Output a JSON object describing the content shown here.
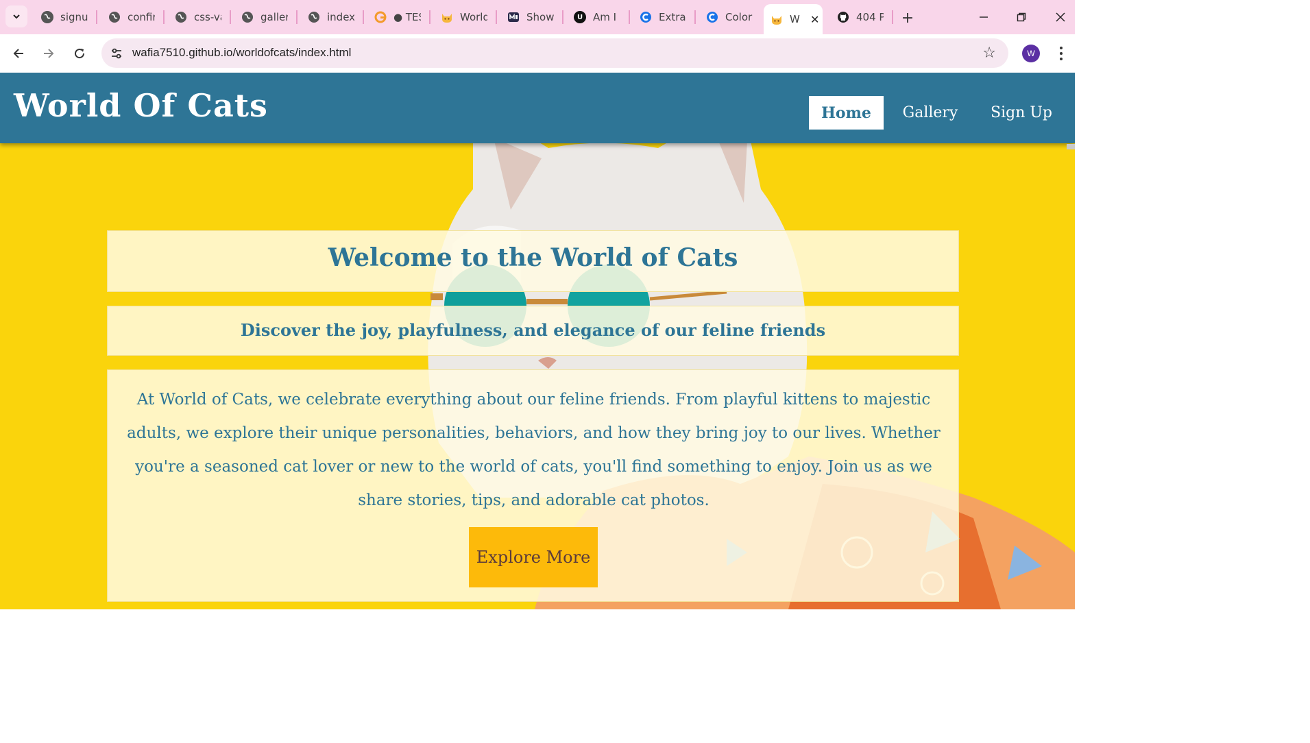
{
  "browser": {
    "tabs": [
      {
        "title": "signup",
        "icon": "globe-icon"
      },
      {
        "title": "confirm",
        "icon": "globe-icon"
      },
      {
        "title": "css-va",
        "icon": "globe-icon"
      },
      {
        "title": "gallery",
        "icon": "globe-icon"
      },
      {
        "title": "index",
        "icon": "globe-icon"
      },
      {
        "title": "● TES",
        "icon": "grammarly-icon"
      },
      {
        "title": "World",
        "icon": "cat-icon"
      },
      {
        "title": "Show",
        "icon": "showcase-icon"
      },
      {
        "title": "Am I",
        "icon": "u-logo-icon"
      },
      {
        "title": "Extrac",
        "icon": "c-logo-icon"
      },
      {
        "title": "Color",
        "icon": "c-logo-icon"
      },
      {
        "title": "W",
        "icon": "cat-icon",
        "active": true
      },
      {
        "title": "404 P",
        "icon": "github-icon"
      }
    ],
    "url": "wafia7510.github.io/worldofcats/index.html",
    "profile_initial": "W",
    "colors": {
      "tabstrip": "#f9d6ea",
      "omnibox": "#f6e8f1",
      "profile": "#5b2fa3"
    }
  },
  "site": {
    "title": "World Of Cats",
    "nav": [
      {
        "label": "Home",
        "current": true
      },
      {
        "label": "Gallery",
        "current": false
      },
      {
        "label": "Sign Up",
        "current": false
      }
    ],
    "colors": {
      "header": "#2e7596",
      "background": "#fad40c",
      "button": "#fdba0a"
    }
  },
  "hero": {
    "heading": "Welcome to the World of Cats",
    "subheading": "Discover the joy, playfulness, and elegance of our feline friends",
    "body": "At World of Cats, we celebrate everything about our feline friends. From playful kittens to majestic adults, we explore their unique personalities, behaviors, and how they bring joy to our lives. Whether you're a seasoned cat lover or new to the world of cats, you'll find something to enjoy. Join us as we share stories, tips, and adorable cat photos.",
    "cta_label": "Explore More",
    "background_image": "cat-with-sunglasses-photo"
  }
}
